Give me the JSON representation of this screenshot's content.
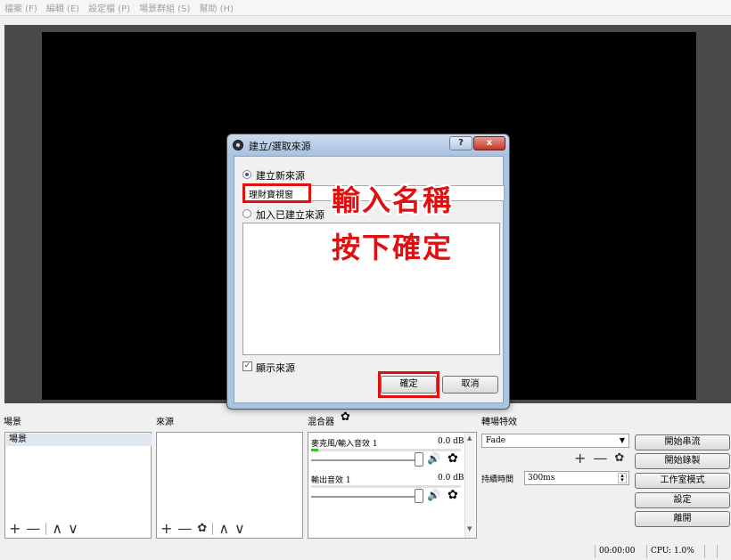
{
  "menu": [
    "檔案 (F)",
    "編輯 (E)",
    "設定檔 (P)",
    "場景群組 (S)",
    "幫助 (H)"
  ],
  "dialog": {
    "title": "建立/選取來源",
    "help_label": "?",
    "close_label": "x",
    "option_new": "建立新來源",
    "name_value": "理財寶視窗",
    "option_existing": "加入已建立來源",
    "show_source": "顯示來源",
    "show_source_checked": true,
    "ok_label": "確定",
    "cancel_label": "取消"
  },
  "annotation": {
    "line1": "輸入名稱",
    "line2": "按下確定",
    "color": "#e01010"
  },
  "scenes": {
    "label": "場景",
    "items": [
      "場景"
    ]
  },
  "sources": {
    "label": "來源"
  },
  "mixer": {
    "label": "混合器",
    "channels": [
      {
        "name": "麥克風/輸入音效 1",
        "db": "0.0 dB",
        "level": 0.05
      },
      {
        "name": "輸出音效 1",
        "db": "0.0 dB",
        "level": 0.0
      }
    ]
  },
  "transitions": {
    "label": "轉場特效",
    "selected": "Fade",
    "duration_label": "持續時間",
    "duration_value": "300ms"
  },
  "controls": {
    "start_stream": "開始串流",
    "start_record": "開始錄製",
    "studio_mode": "工作室模式",
    "settings": "設定",
    "exit": "離開"
  },
  "status": {
    "time": "00:00:00",
    "cpu": "CPU: 1.0%"
  },
  "toolbar_symbols": {
    "add": "+",
    "remove": "—",
    "up": "∧",
    "down": "∨",
    "gear": "✿",
    "speaker": "🔊"
  }
}
